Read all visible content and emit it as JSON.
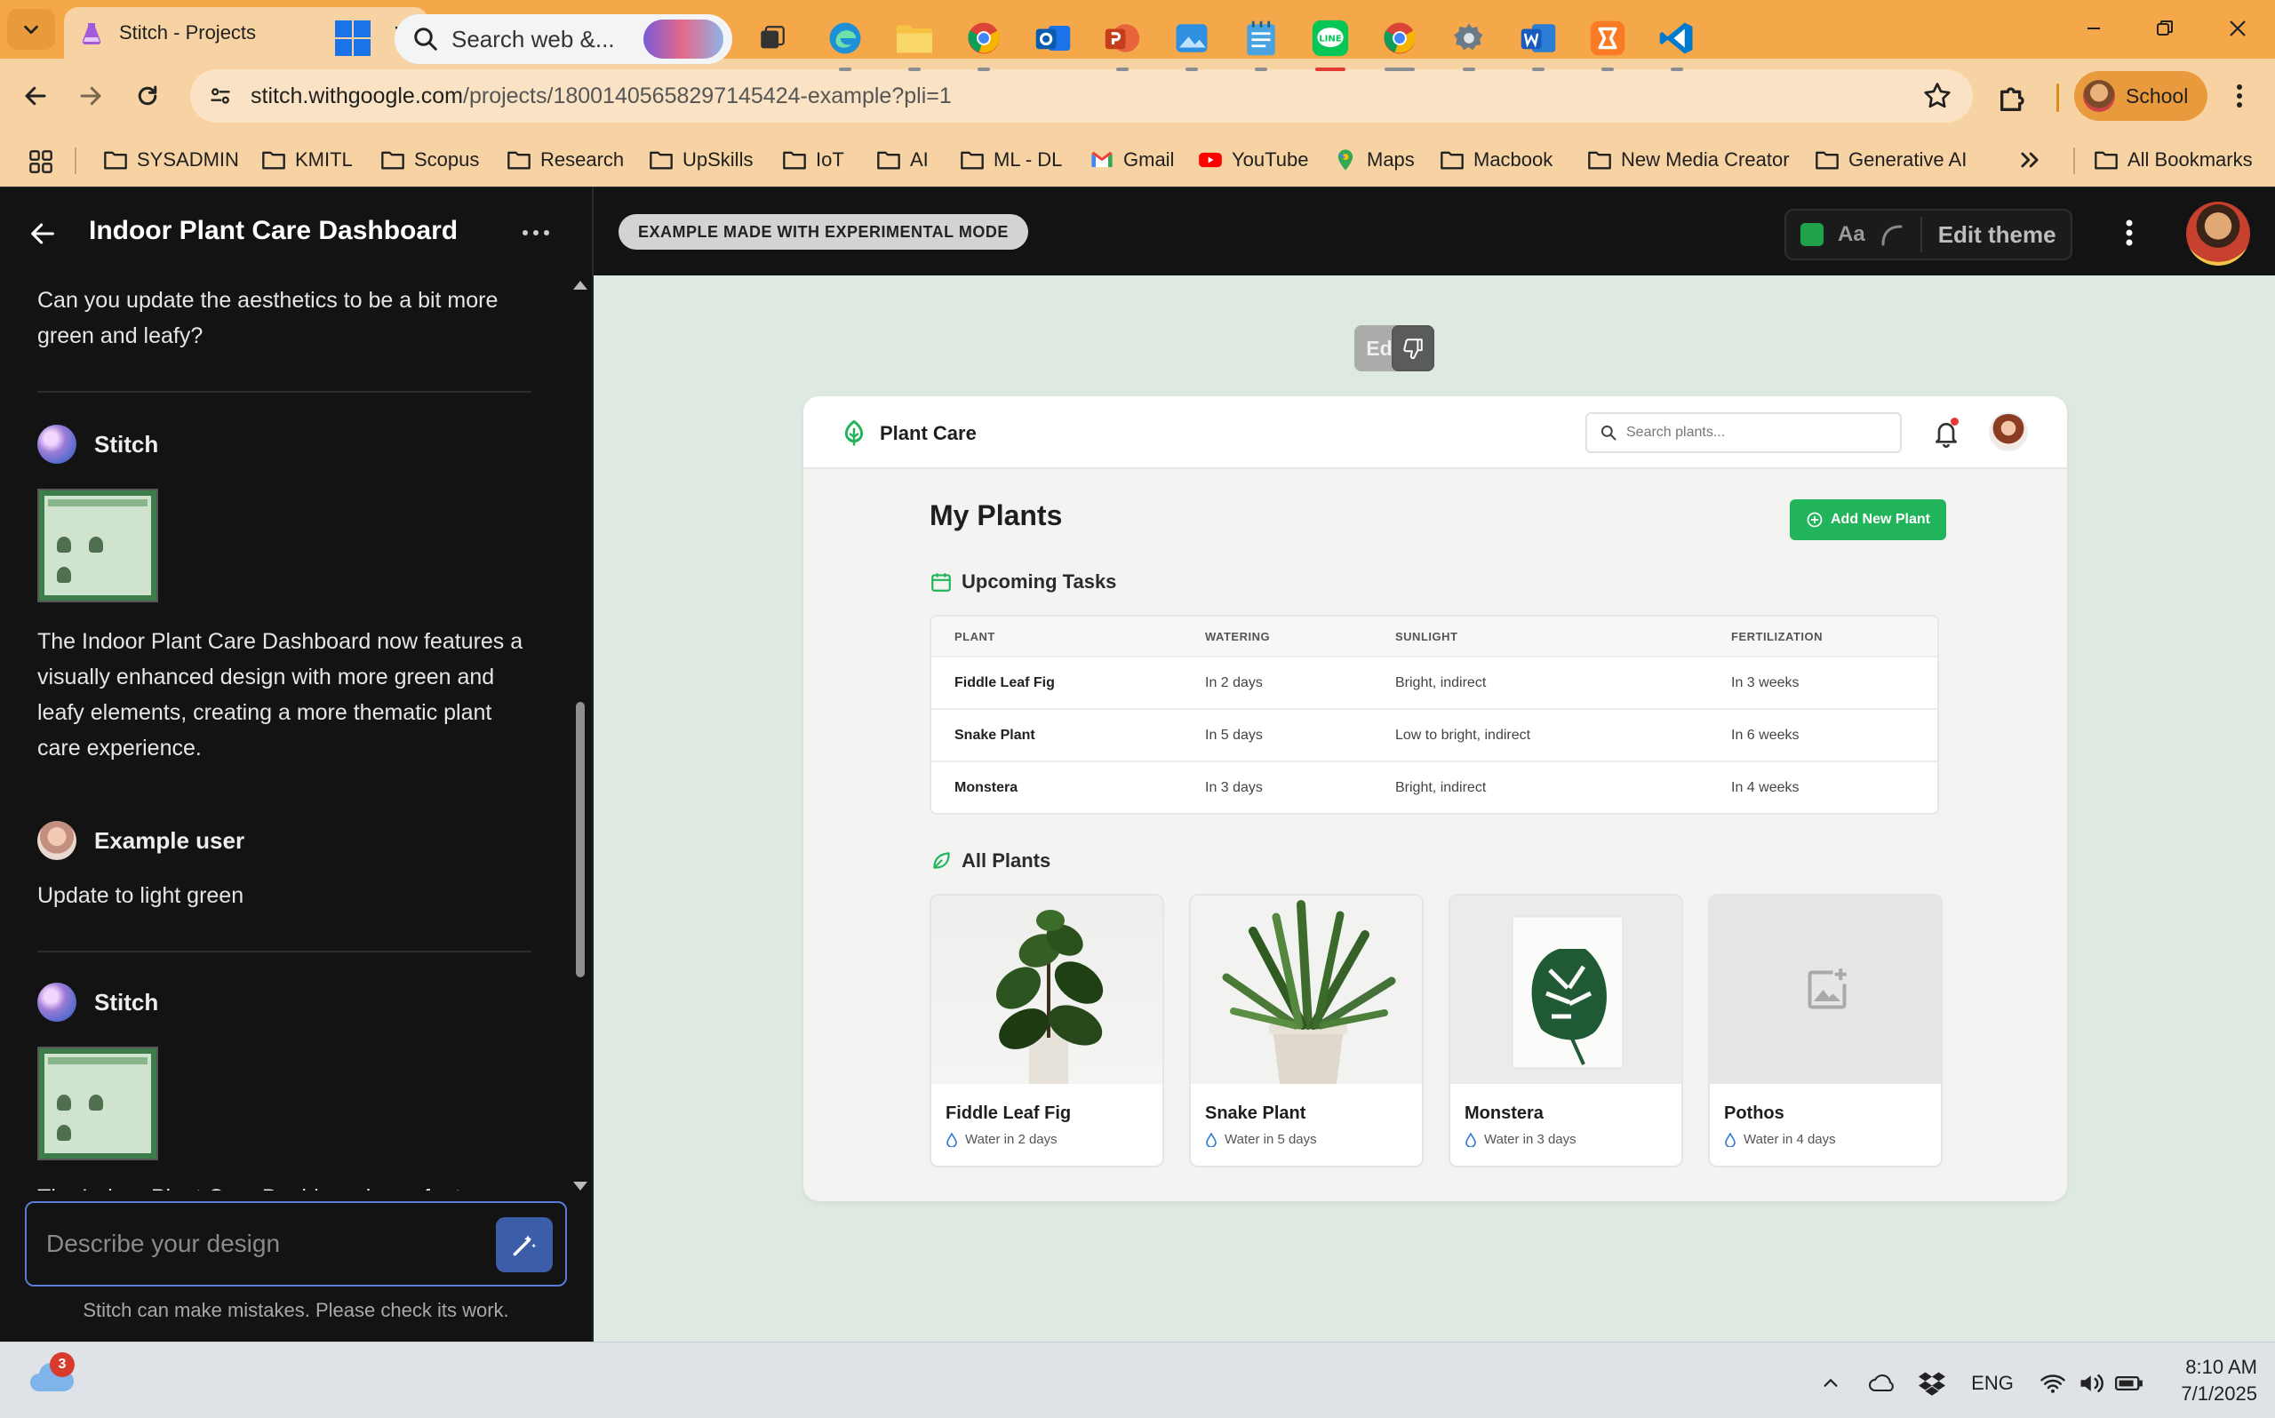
{
  "browser": {
    "tab_title": "Stitch - Projects",
    "url_host": "stitch.withgoogle.com",
    "url_path": "/projects/18001405658297145424-example?pli=1",
    "profile_label": "School",
    "bookmarks": [
      "SYSADMIN",
      "KMITL",
      "Scopus",
      "Research",
      "UpSkills",
      "IoT",
      "AI",
      "ML - DL",
      "Gmail",
      "YouTube",
      "Maps",
      "Macbook",
      "New Media Creator",
      "Generative AI"
    ],
    "all_bookmarks": "All Bookmarks",
    "accent": "#f5a84a"
  },
  "app": {
    "project_title": "Indoor Plant Care Dashboard",
    "experimental_badge": "EXAMPLE MADE WITH EXPERIMENTAL MODE",
    "theme_aa": "Aa",
    "edit_theme": "Edit theme",
    "theme_color": "#1fa34a"
  },
  "chat": {
    "messages": [
      {
        "role": "user_text",
        "text": "Can you update the aesthetics to be a bit more green and leafy?"
      },
      {
        "role": "author",
        "name": "Stitch"
      },
      {
        "role": "assistant_text",
        "text": "The Indoor Plant Care Dashboard now features a visually enhanced design with more green and leafy elements, creating a more thematic plant care experience."
      },
      {
        "role": "author",
        "name": "Example user"
      },
      {
        "role": "user_text",
        "text": "Update to light green"
      },
      {
        "role": "author",
        "name": "Stitch"
      },
      {
        "role": "assistant_text",
        "text": "The Indoor Plant Care Dashboard now features a"
      }
    ],
    "input_placeholder": "Describe your design",
    "disclaimer": "Stitch can make mistakes. Please check its work."
  },
  "canvas": {
    "edit_label": "Edit",
    "mock": {
      "brand": "Plant Care",
      "search_placeholder": "Search plants...",
      "page_title": "My Plants",
      "add_button": "Add New Plant",
      "tasks_title": "Upcoming Tasks",
      "task_columns": [
        "PLANT",
        "WATERING",
        "SUNLIGHT",
        "FERTILIZATION"
      ],
      "tasks": [
        {
          "plant": "Fiddle Leaf Fig",
          "watering": "In 2 days",
          "sunlight": "Bright, indirect",
          "fertilization": "In 3 weeks"
        },
        {
          "plant": "Snake Plant",
          "watering": "In 5 days",
          "sunlight": "Low to bright, indirect",
          "fertilization": "In 6 weeks"
        },
        {
          "plant": "Monstera",
          "watering": "In 3 days",
          "sunlight": "Bright, indirect",
          "fertilization": "In 4 weeks"
        }
      ],
      "all_plants_title": "All Plants",
      "plants": [
        {
          "name": "Fiddle Leaf Fig",
          "water": "Water in 2 days"
        },
        {
          "name": "Snake Plant",
          "water": "Water in 5 days"
        },
        {
          "name": "Monstera",
          "water": "Water in 3 days"
        },
        {
          "name": "Pothos",
          "water": "Water in 4 days"
        }
      ],
      "accent": "#22b45a"
    }
  },
  "taskbar": {
    "weather_badge": "3",
    "search_placeholder": "Search web &...",
    "language": "ENG",
    "time": "8:10 AM",
    "date": "7/1/2025"
  }
}
